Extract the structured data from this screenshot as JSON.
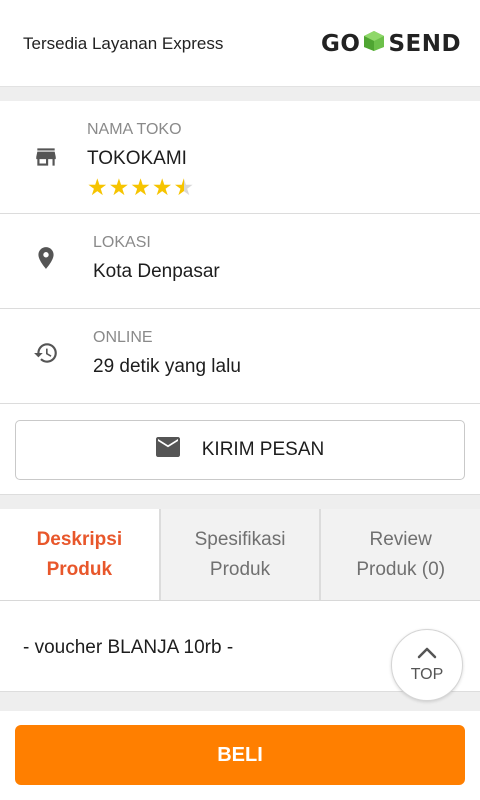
{
  "express": {
    "label": "Tersedia Layanan Express",
    "logo_left": "GO",
    "logo_right": "SEND",
    "logo_accent": "#6cc04a"
  },
  "store": {
    "name_label": "NAMA TOKO",
    "name": "TOKOKAMI",
    "rating": 4.5,
    "stars_max": 5,
    "location_label": "LOKASI",
    "location": "Kota Denpasar",
    "online_label": "ONLINE",
    "online": "29 detik yang lalu",
    "message_button": "KIRIM PESAN",
    "icons": {
      "store": "store-icon",
      "location": "location-pin-icon",
      "online": "history-icon",
      "message": "mail-icon"
    }
  },
  "tabs": [
    {
      "label": "Deskripsi\nProduk",
      "active": true
    },
    {
      "label": "Spesifikasi\nProduk",
      "active": false
    },
    {
      "label": "Review\nProduk (0)",
      "active": false
    }
  ],
  "description": {
    "text": "- voucher BLANJA 10rb -"
  },
  "scroll_top": {
    "label": "TOP",
    "icon": "chevron-up-icon"
  },
  "buy": {
    "label": "BELI",
    "color": "#ff7f00"
  },
  "colors": {
    "accent_tab": "#e8572b",
    "star": "#f6c400"
  }
}
